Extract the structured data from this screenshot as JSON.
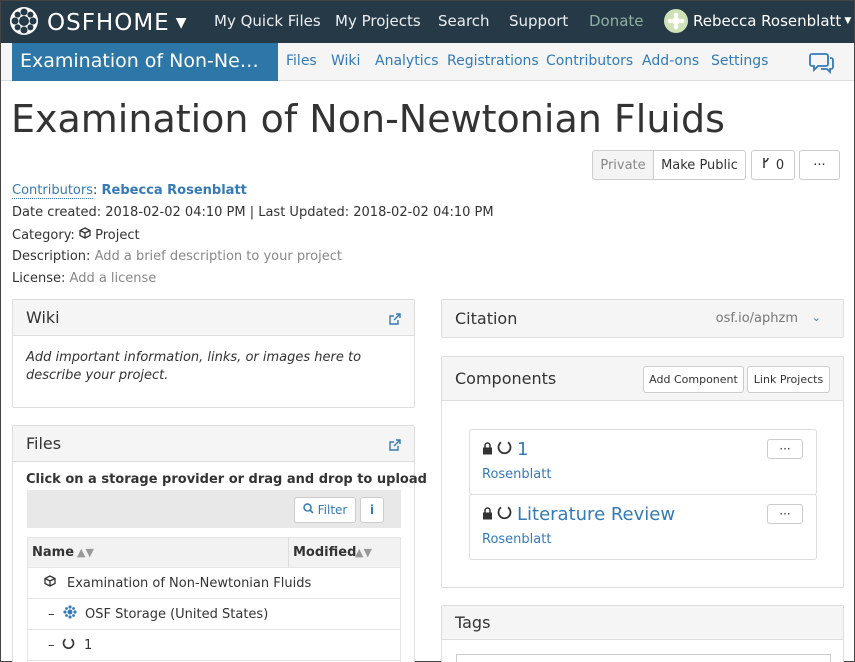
{
  "nav": {
    "brand": "OSFHOME",
    "links": [
      "My Quick Files",
      "My Projects",
      "Search",
      "Support",
      "Donate"
    ],
    "user": "Rebecca Rosenblatt"
  },
  "project_nav": {
    "title": "Examination of Non-Newtonian Fluids",
    "links": [
      "Files",
      "Wiki",
      "Analytics",
      "Registrations",
      "Contributors",
      "Add-ons",
      "Settings"
    ]
  },
  "project": {
    "title": "Examination of Non-Newtonian Fluids",
    "private_label": "Private",
    "make_public_label": "Make Public",
    "fork_count": "0",
    "more_label": "···"
  },
  "meta": {
    "contributors_label": "Contributors",
    "contributor": "Rebecca Rosenblatt",
    "dates": "Date created: 2018-02-02 04:10 PM | Last Updated: 2018-02-02 04:10 PM",
    "category_label": "Category:",
    "category": "Project",
    "description_label": "Description:",
    "description_placeholder": "Add a brief description to your project",
    "license_label": "License:",
    "license_placeholder": "Add a license"
  },
  "wiki": {
    "heading": "Wiki",
    "placeholder": "Add important information, links, or images here to describe your project."
  },
  "files": {
    "heading": "Files",
    "instruction": "Click on a storage provider or drag and drop to upload",
    "filter_label": "Filter",
    "info_label": "i",
    "col_name": "Name",
    "col_modified": "Modified",
    "rows": [
      {
        "name": "Examination of Non-Newtonian Fluids"
      },
      {
        "name": "OSF Storage (United States)"
      },
      {
        "name": "1"
      }
    ]
  },
  "citation": {
    "heading": "Citation",
    "link": "osf.io/aphzm"
  },
  "components": {
    "heading": "Components",
    "add_label": "Add Component",
    "link_label": "Link Projects",
    "items": [
      {
        "title": "1",
        "contributor": "Rosenblatt",
        "more": "···"
      },
      {
        "title": "Literature Review",
        "contributor": "Rosenblatt",
        "more": "···"
      }
    ]
  },
  "tags": {
    "heading": "Tags"
  },
  "colors": {
    "navbar": "#263947",
    "accent": "#337ab7",
    "project_title_bg": "#2d77a8"
  }
}
